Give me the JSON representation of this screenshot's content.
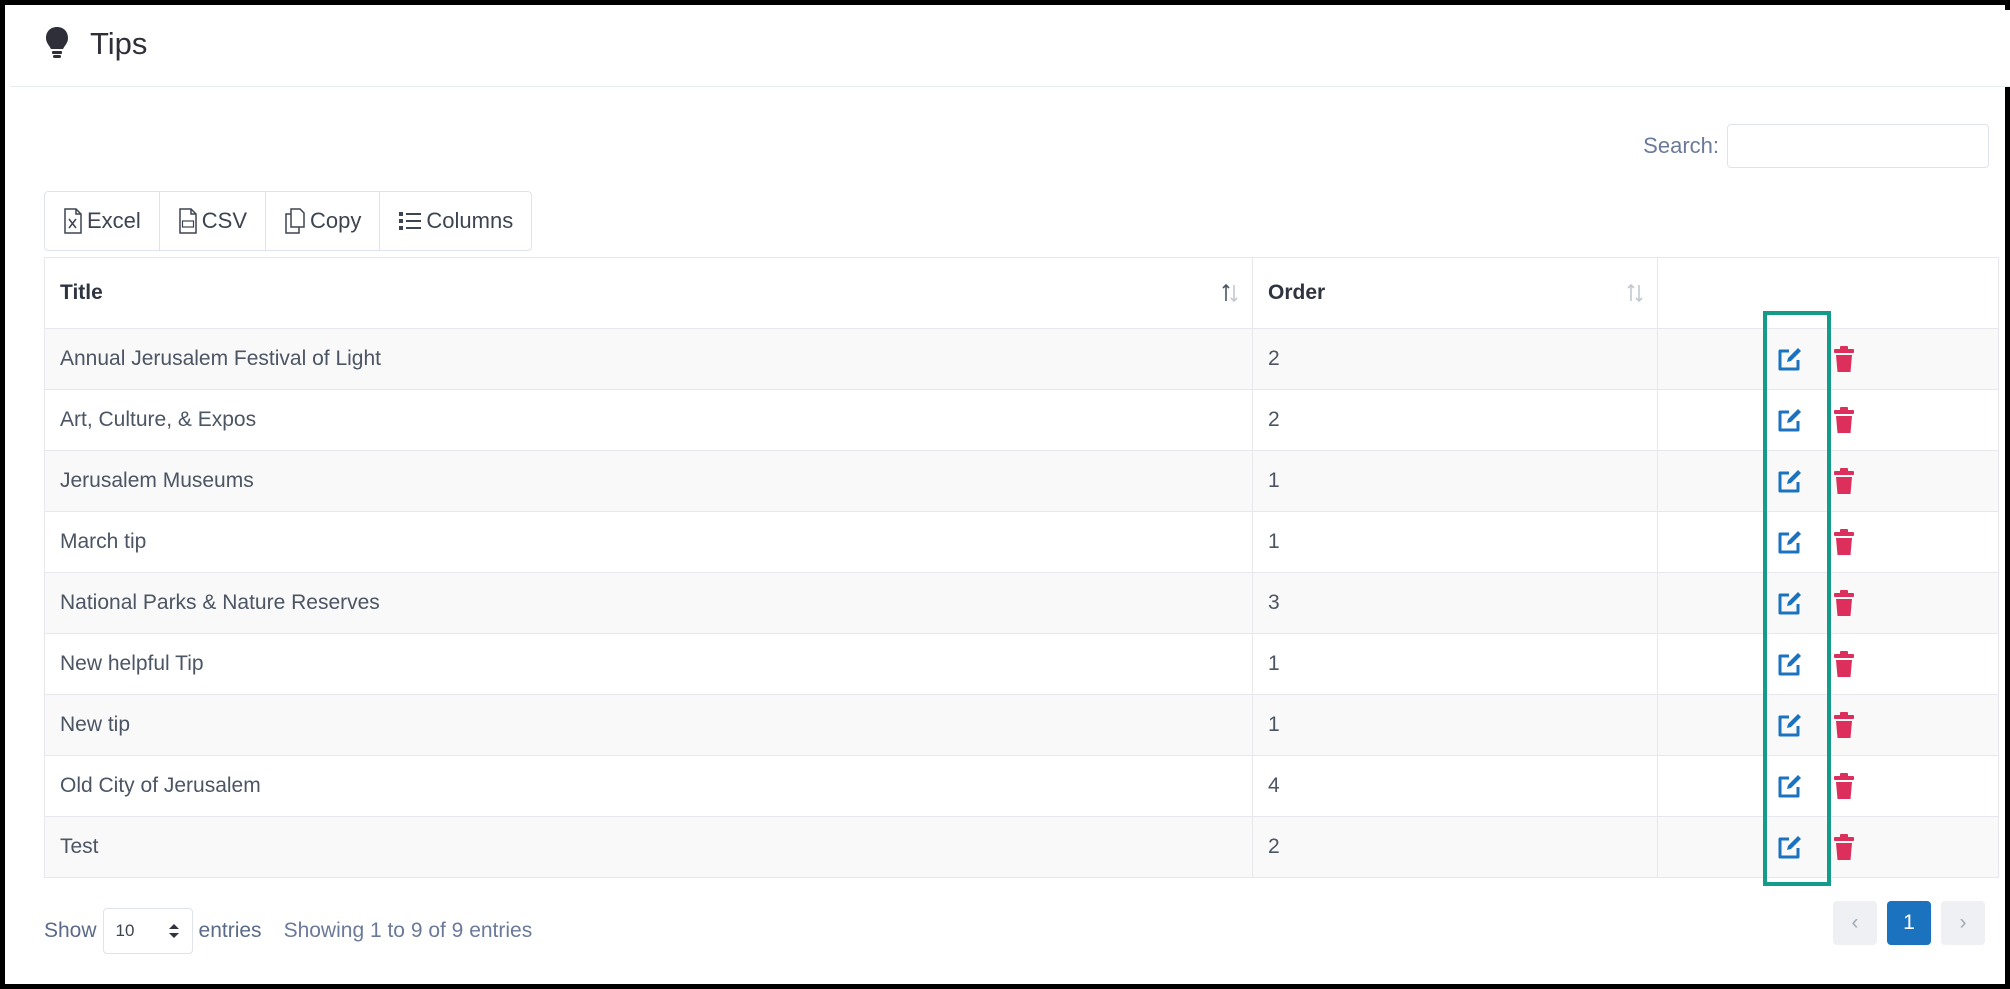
{
  "header": {
    "title": "Tips",
    "icon": "lightbulb-icon"
  },
  "search": {
    "label": "Search:",
    "value": "",
    "placeholder": ""
  },
  "toolbar": {
    "excel_label": "Excel",
    "csv_label": "CSV",
    "copy_label": "Copy",
    "columns_label": "Columns"
  },
  "table": {
    "columns": [
      "Title",
      "Order",
      ""
    ],
    "rows": [
      {
        "title": "Annual Jerusalem Festival of Light",
        "order": "2"
      },
      {
        "title": "Art, Culture, & Expos",
        "order": "2"
      },
      {
        "title": "Jerusalem Museums",
        "order": "1"
      },
      {
        "title": "March tip",
        "order": "1"
      },
      {
        "title": "National Parks & Nature Reserves",
        "order": "3"
      },
      {
        "title": "New helpful Tip",
        "order": "1"
      },
      {
        "title": "New tip",
        "order": "1"
      },
      {
        "title": "Old City of Jerusalem",
        "order": "4"
      },
      {
        "title": "Test",
        "order": "2"
      }
    ],
    "row_actions": [
      "edit-icon",
      "trash-icon"
    ]
  },
  "footer": {
    "show_label": "Show",
    "page_length": "10",
    "entries_label": "entries",
    "info": "Showing 1 to 9 of 9 entries"
  },
  "pagination": {
    "prev": "‹",
    "current": "1",
    "next": "›"
  },
  "colors": {
    "accent": "#1b73c0",
    "danger": "#dc2f5c",
    "highlight": "#149c8a"
  }
}
